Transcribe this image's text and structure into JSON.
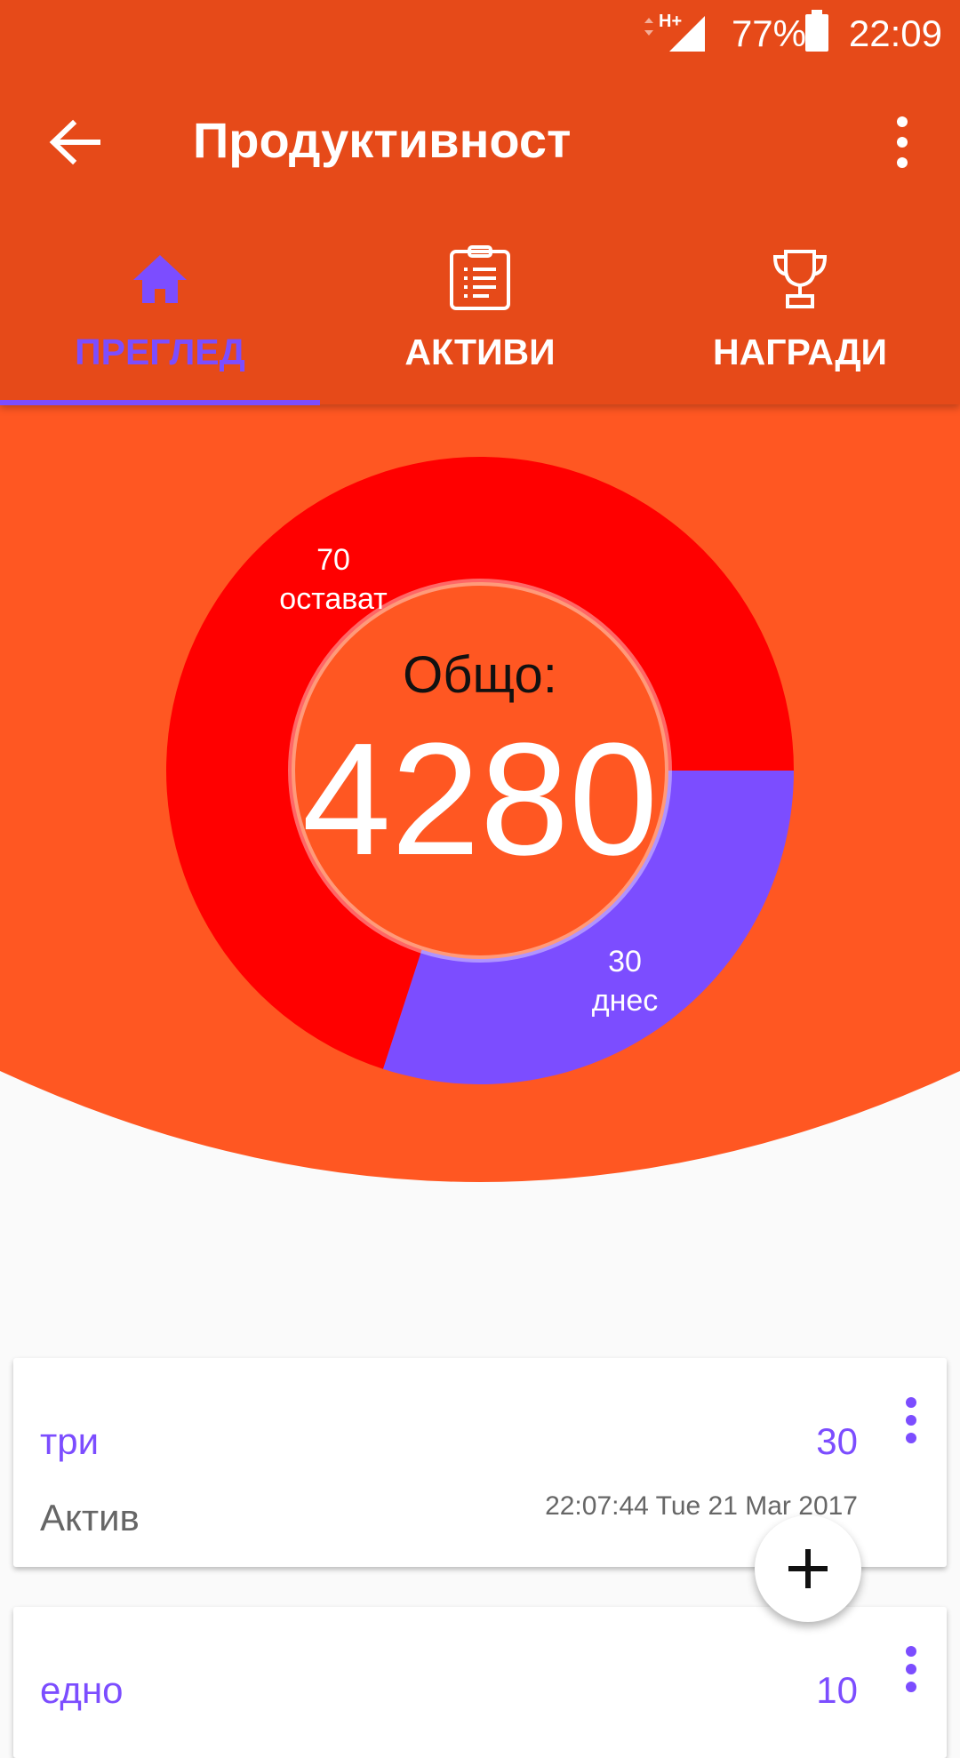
{
  "status_bar": {
    "network": "H+",
    "battery": "77%",
    "time": "22:09"
  },
  "toolbar": {
    "title": "Продуктивност",
    "back_icon": "arrow-left-icon",
    "menu_icon": "more-vertical-icon"
  },
  "tabs": [
    {
      "label": "ПРЕГЛЕД",
      "icon": "home-icon",
      "active": true
    },
    {
      "label": "АКТИВИ",
      "icon": "clipboard-list-icon",
      "active": false
    },
    {
      "label": "НАГРАДИ",
      "icon": "trophy-icon",
      "active": false
    }
  ],
  "summary": {
    "total_label": "Общо:",
    "total_value": "4280"
  },
  "chart_data": {
    "type": "pie",
    "categories": [
      "остават",
      "днес"
    ],
    "values": [
      70,
      30
    ],
    "labels": [
      {
        "value": "70",
        "text": "остават"
      },
      {
        "value": "30",
        "text": "днес"
      }
    ],
    "colors": [
      "#ff0000",
      "#7c4dff"
    ]
  },
  "cards": [
    {
      "name": "три",
      "value": "30",
      "status": "Актив",
      "date": "22:07:44 Tue 21 Mar 2017"
    },
    {
      "name": "едно",
      "value": "10"
    }
  ],
  "colors": {
    "primary": "#e64a19",
    "hero": "#ff5722",
    "accent": "#7c4dff",
    "remaining": "#ff0000"
  }
}
